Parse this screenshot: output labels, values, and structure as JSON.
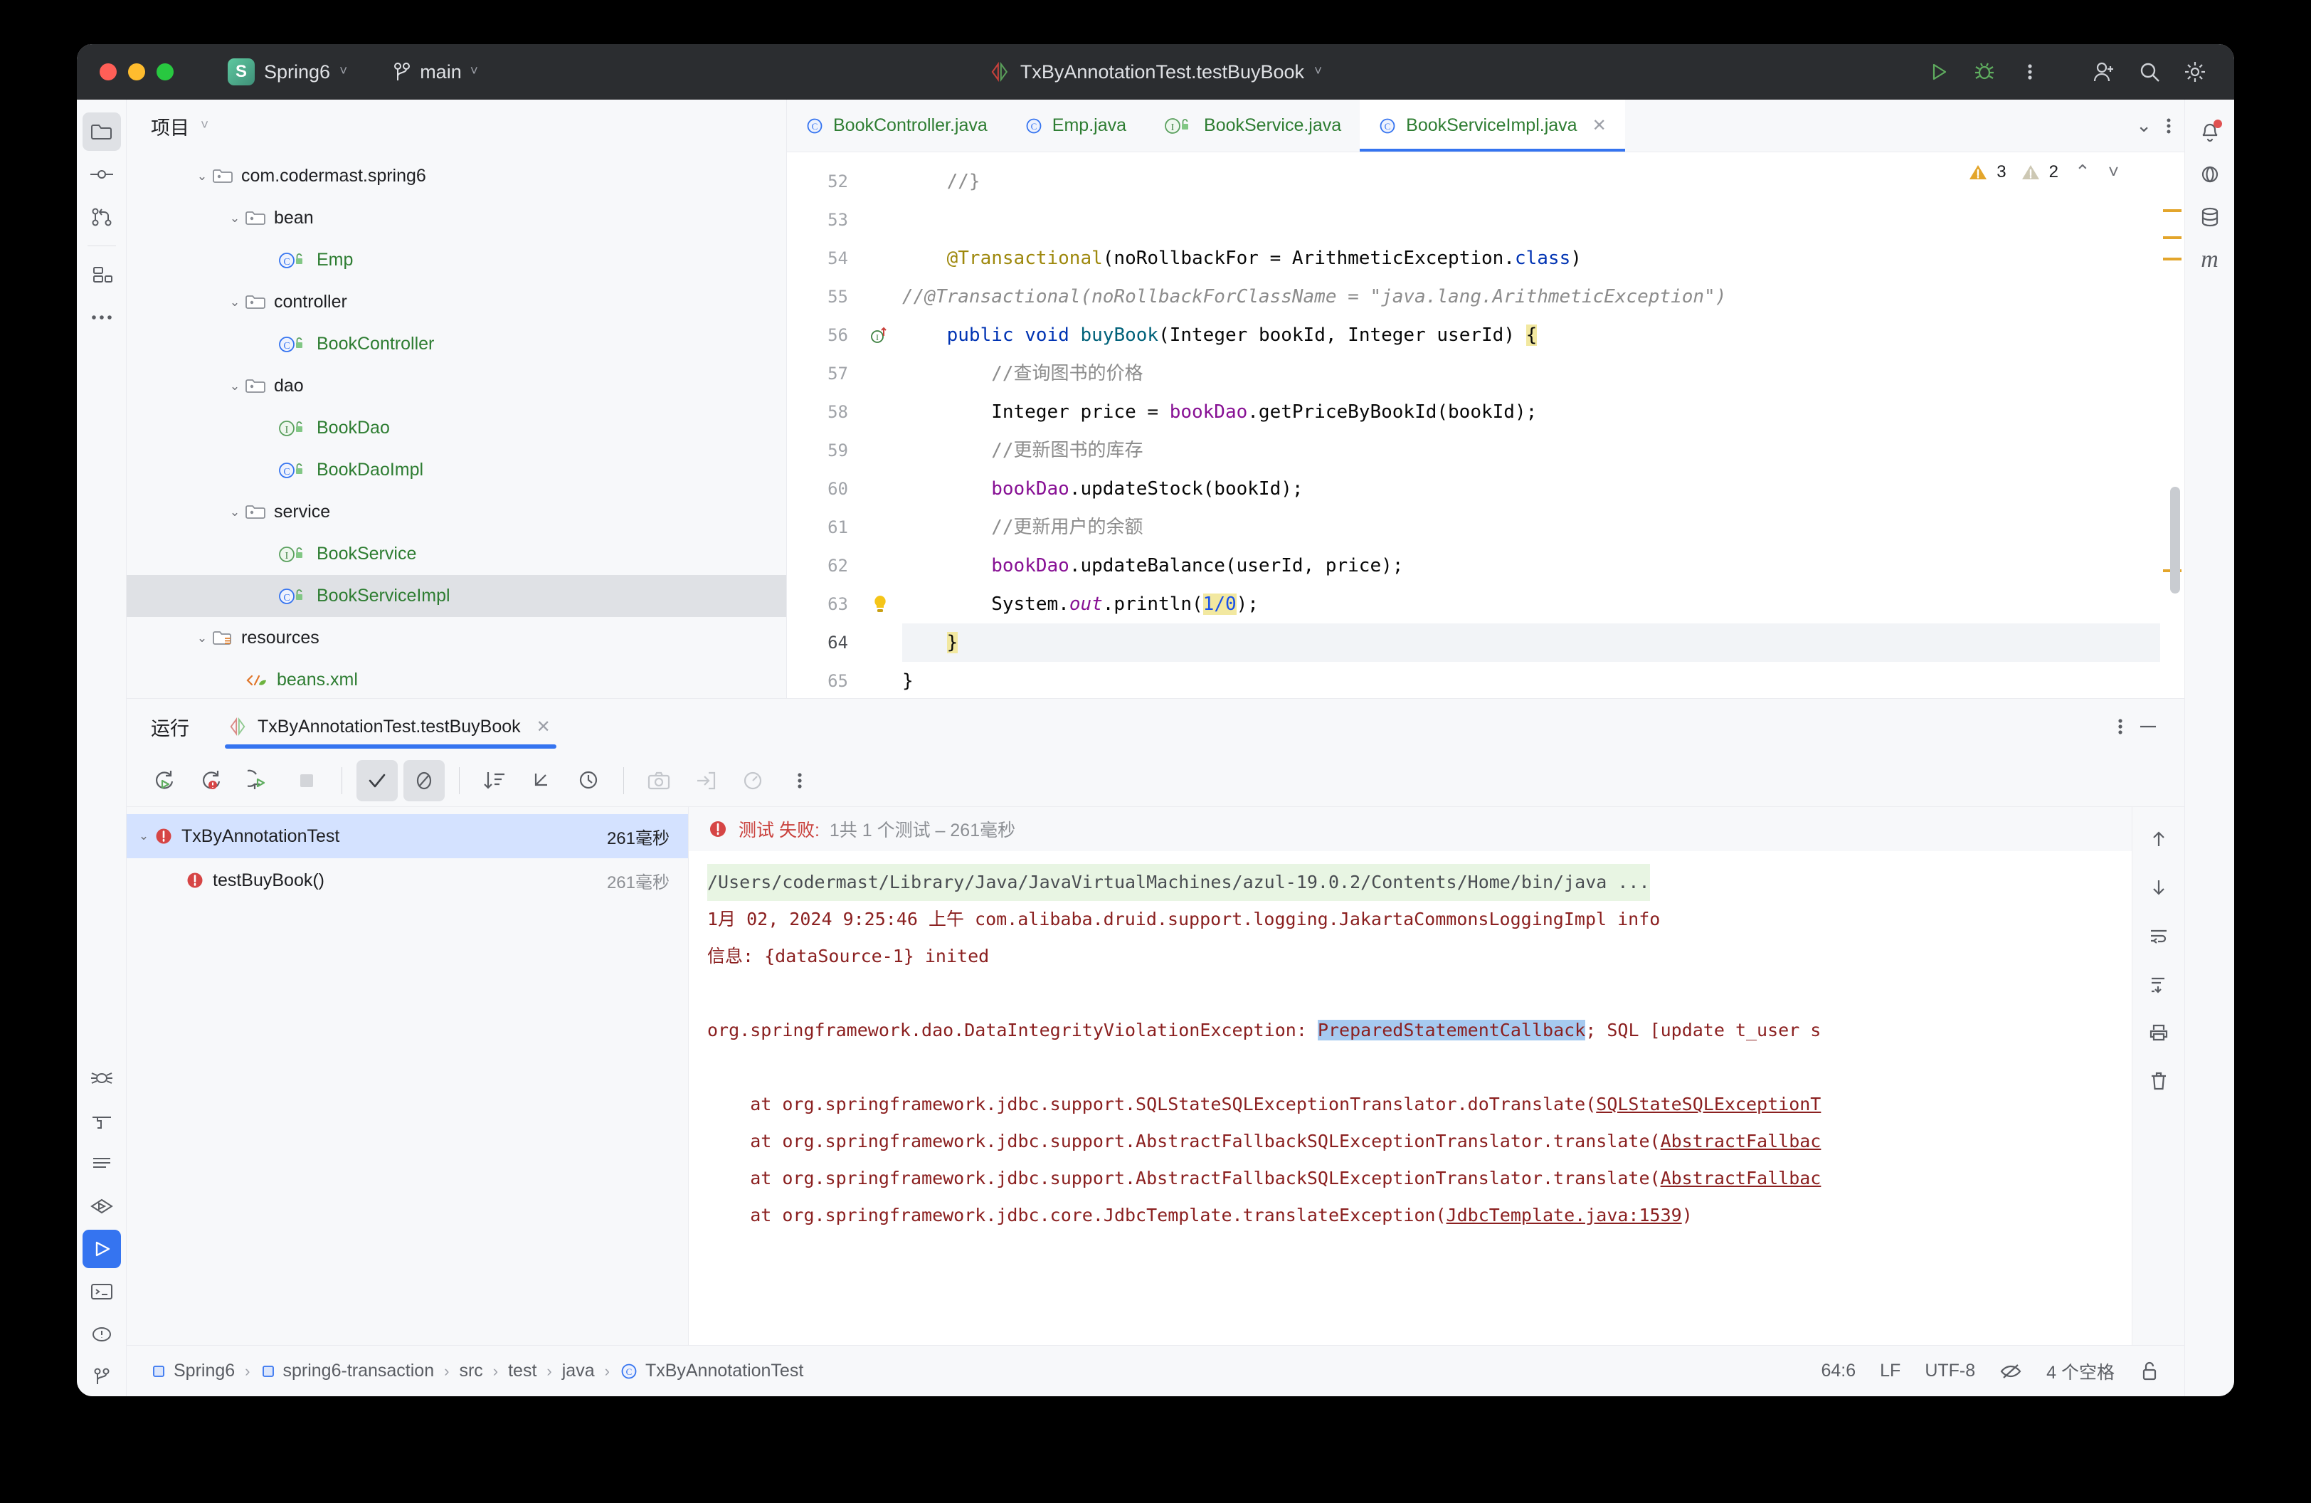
{
  "titlebar": {
    "project_name": "Spring6",
    "project_badge": "S",
    "branch": "main",
    "run_config": "TxByAnnotationTest.testBuyBook",
    "icons": {
      "run": "run-icon",
      "debug": "debug-icon",
      "more": "more-vertical-icon",
      "account": "account-icon",
      "search": "search-icon",
      "settings": "settings-icon"
    }
  },
  "rail": {
    "top": [
      {
        "name": "project-tool-window",
        "label": "Project",
        "selected": true
      },
      {
        "name": "commit-tool-window",
        "label": "Commit",
        "selected": false
      },
      {
        "name": "pull-requests-tool-window",
        "label": "Pull Requests",
        "selected": false
      },
      {
        "name": "structure-tool-window",
        "label": "Structure",
        "selected": false
      },
      {
        "name": "more-tool-windows",
        "label": "More",
        "selected": false
      }
    ],
    "bottom": [
      {
        "name": "debug-tool-window",
        "label": "Debug",
        "active": false
      },
      {
        "name": "build-tool-window",
        "label": "Build",
        "active": false
      },
      {
        "name": "notifications-tool-window",
        "label": "Notifications",
        "active": false
      },
      {
        "name": "services-tool-window",
        "label": "Services",
        "active": false
      },
      {
        "name": "run-tool-window",
        "label": "Run",
        "active": true
      },
      {
        "name": "terminal-tool-window",
        "label": "Terminal",
        "active": false
      },
      {
        "name": "problems-tool-window",
        "label": "Problems",
        "active": false
      },
      {
        "name": "git-tool-window",
        "label": "Git",
        "active": false
      }
    ]
  },
  "right_rail": [
    {
      "name": "notifications-icon",
      "label": "Notifications",
      "badge": true
    },
    {
      "name": "ai-assistant-icon",
      "label": "AI Assistant"
    },
    {
      "name": "database-icon",
      "label": "Database"
    },
    {
      "name": "maven-icon",
      "label": "Maven"
    }
  ],
  "project_panel": {
    "title": "项目",
    "tree": [
      {
        "depth": 2,
        "arrow": "down",
        "icon": "package-icon",
        "label": "com.codermast.spring6",
        "color": "black"
      },
      {
        "depth": 3,
        "arrow": "down",
        "icon": "package-icon",
        "label": "bean",
        "color": "black"
      },
      {
        "depth": 4,
        "arrow": "none",
        "icon": "class-icon",
        "label": "Emp",
        "color": "green"
      },
      {
        "depth": 3,
        "arrow": "down",
        "icon": "package-icon",
        "label": "controller",
        "color": "black"
      },
      {
        "depth": 4,
        "arrow": "none",
        "icon": "class-icon",
        "label": "BookController",
        "color": "green"
      },
      {
        "depth": 3,
        "arrow": "down",
        "icon": "package-icon",
        "label": "dao",
        "color": "black"
      },
      {
        "depth": 4,
        "arrow": "none",
        "icon": "interface-icon",
        "label": "BookDao",
        "color": "green"
      },
      {
        "depth": 4,
        "arrow": "none",
        "icon": "class-icon",
        "label": "BookDaoImpl",
        "color": "green"
      },
      {
        "depth": 3,
        "arrow": "down",
        "icon": "package-icon",
        "label": "service",
        "color": "black"
      },
      {
        "depth": 4,
        "arrow": "none",
        "icon": "interface-icon",
        "label": "BookService",
        "color": "green"
      },
      {
        "depth": 4,
        "arrow": "none",
        "icon": "class-icon",
        "label": "BookServiceImpl",
        "color": "green",
        "selected": true
      },
      {
        "depth": 2,
        "arrow": "down",
        "icon": "resources-folder-icon",
        "label": "resources",
        "color": "black"
      },
      {
        "depth": 3,
        "arrow": "none",
        "icon": "xml-spring-icon",
        "label": "beans.xml",
        "color": "green"
      }
    ]
  },
  "editor": {
    "tabs": [
      {
        "label": "BookController.java",
        "icon": "class-icon",
        "active": false
      },
      {
        "label": "Emp.java",
        "icon": "class-icon",
        "active": false
      },
      {
        "label": "BookService.java",
        "icon": "interface-icon",
        "active": false
      },
      {
        "label": "BookServiceImpl.java",
        "icon": "class-icon",
        "active": true
      }
    ],
    "inspection": {
      "warnings": "3",
      "weak_warnings": "2"
    },
    "first_line": 52,
    "current_line": 64,
    "lines": [
      {
        "n": 52,
        "gutter": "",
        "tokens": [
          {
            "t": "    //}",
            "c": "cmt"
          }
        ]
      },
      {
        "n": 53,
        "gutter": "",
        "tokens": [
          {
            "t": "",
            "c": ""
          }
        ]
      },
      {
        "n": 54,
        "gutter": "",
        "tokens": [
          {
            "t": "    ",
            "c": ""
          },
          {
            "t": "@Transactional",
            "c": "ann"
          },
          {
            "t": "(noRollbackFor = ArithmeticException.",
            "c": ""
          },
          {
            "t": "class",
            "c": "kw"
          },
          {
            "t": ")",
            "c": ""
          }
        ]
      },
      {
        "n": 55,
        "gutter": "",
        "tokens": [
          {
            "t": "//@Transactional(noRollbackForClassName = \"java.lang.ArithmeticException\")",
            "c": "cmt-i"
          }
        ]
      },
      {
        "n": 56,
        "gutter": "implemented-method-icon",
        "tokens": [
          {
            "t": "    ",
            "c": ""
          },
          {
            "t": "public",
            "c": "kw"
          },
          {
            "t": " ",
            "c": ""
          },
          {
            "t": "void",
            "c": "kw"
          },
          {
            "t": " ",
            "c": ""
          },
          {
            "t": "buyBook",
            "c": "mth"
          },
          {
            "t": "(Integer bookId, Integer userId) ",
            "c": ""
          },
          {
            "t": "{",
            "c": "caret-hl"
          }
        ]
      },
      {
        "n": 57,
        "gutter": "",
        "tokens": [
          {
            "t": "        //查询图书的价格",
            "c": "cmt"
          }
        ]
      },
      {
        "n": 58,
        "gutter": "",
        "tokens": [
          {
            "t": "        Integer price = ",
            "c": ""
          },
          {
            "t": "bookDao",
            "c": "fld"
          },
          {
            "t": ".getPriceByBookId(bookId);",
            "c": ""
          }
        ]
      },
      {
        "n": 59,
        "gutter": "",
        "tokens": [
          {
            "t": "        //更新图书的库存",
            "c": "cmt"
          }
        ]
      },
      {
        "n": 60,
        "gutter": "",
        "tokens": [
          {
            "t": "        ",
            "c": ""
          },
          {
            "t": "bookDao",
            "c": "fld"
          },
          {
            "t": ".updateStock(bookId);",
            "c": ""
          }
        ]
      },
      {
        "n": 61,
        "gutter": "",
        "tokens": [
          {
            "t": "        //更新用户的余额",
            "c": "cmt"
          }
        ]
      },
      {
        "n": 62,
        "gutter": "",
        "tokens": [
          {
            "t": "        ",
            "c": ""
          },
          {
            "t": "bookDao",
            "c": "fld"
          },
          {
            "t": ".updateBalance(userId, price);",
            "c": ""
          }
        ]
      },
      {
        "n": 63,
        "gutter": "intention-bulb-icon",
        "tokens": [
          {
            "t": "        System.",
            "c": ""
          },
          {
            "t": "out",
            "c": "stat"
          },
          {
            "t": ".println(",
            "c": ""
          },
          {
            "t": "1/0",
            "c": "num"
          },
          {
            "t": ");",
            "c": ""
          }
        ]
      },
      {
        "n": 64,
        "gutter": "",
        "tokens": [
          {
            "t": "    ",
            "c": ""
          },
          {
            "t": "}",
            "c": "caret-hl"
          }
        ]
      },
      {
        "n": 65,
        "gutter": "",
        "tokens": [
          {
            "t": "}",
            "c": ""
          }
        ]
      }
    ]
  },
  "run_panel": {
    "title": "运行",
    "tab_label": "TxByAnnotationTest.testBuyBook",
    "toolbar": [
      {
        "name": "rerun-button",
        "label": "Rerun",
        "state": "normal"
      },
      {
        "name": "rerun-failed-tests-button",
        "label": "Rerun Failed Tests",
        "state": "normal"
      },
      {
        "name": "rerun-with-debug-button",
        "label": "Debug",
        "state": "normal"
      },
      {
        "name": "stop-button",
        "label": "Stop",
        "state": "disabled"
      },
      {
        "name": "show-passed-toggle",
        "label": "Show Passed",
        "state": "on"
      },
      {
        "name": "show-ignored-toggle",
        "label": "Show Ignored",
        "state": "on"
      },
      {
        "name": "sort-by-duration-button",
        "label": "Sort by Duration",
        "state": "normal"
      },
      {
        "name": "expand-collapse-button",
        "label": "Expand/Collapse",
        "state": "normal"
      },
      {
        "name": "test-history-button",
        "label": "Test History",
        "state": "normal"
      },
      {
        "name": "screenshot-button",
        "label": "Screenshot",
        "state": "disabled"
      },
      {
        "name": "export-button",
        "label": "Export",
        "state": "disabled"
      },
      {
        "name": "profiler-button",
        "label": "Profiler",
        "state": "disabled"
      },
      {
        "name": "more-options-button",
        "label": "More",
        "state": "normal"
      }
    ],
    "tests": [
      {
        "label": "TxByAnnotationTest",
        "duration": "261毫秒",
        "status": "failed",
        "expandable": true,
        "selected": true,
        "indent": 0
      },
      {
        "label": "testBuyBook()",
        "duration": "261毫秒",
        "status": "failed",
        "expandable": false,
        "selected": false,
        "indent": 1
      }
    ],
    "failure_header": {
      "red": "测试 失败:",
      "gray": "1共 1 个测试 – 261毫秒"
    },
    "console": [
      {
        "type": "cmd",
        "text": "/Users/codermast/Library/Java/JavaVirtualMachines/azul-19.0.2/Contents/Home/bin/java ..."
      },
      {
        "type": "err",
        "text": "1月 02, 2024 9:25:46 上午 com.alibaba.druid.support.logging.JakartaCommonsLoggingImpl info"
      },
      {
        "type": "err",
        "text": "信息: {dataSource-1} inited"
      },
      {
        "type": "blank",
        "text": ""
      },
      {
        "type": "err-sel",
        "pre": "org.springframework.dao.DataIntegrityViolationException: ",
        "sel": "PreparedStatementCallback",
        "post": "; SQL [update t_user s"
      },
      {
        "type": "blank",
        "text": ""
      },
      {
        "type": "err-link",
        "pre": "    at org.springframework.jdbc.support.SQLStateSQLExceptionTranslator.doTranslate(",
        "link": "SQLStateSQLExceptionT"
      },
      {
        "type": "err-link",
        "pre": "    at org.springframework.jdbc.support.AbstractFallbackSQLExceptionTranslator.translate(",
        "link": "AbstractFallbac"
      },
      {
        "type": "err-link",
        "pre": "    at org.springframework.jdbc.support.AbstractFallbackSQLExceptionTranslator.translate(",
        "link": "AbstractFallbac"
      },
      {
        "type": "err-link",
        "pre": "    at org.springframework.jdbc.core.JdbcTemplate.translateException(",
        "link": "JdbcTemplate.java:1539",
        "post": ")"
      }
    ],
    "console_rail": [
      {
        "name": "scroll-up-icon",
        "label": "Up"
      },
      {
        "name": "scroll-down-icon",
        "label": "Down"
      },
      {
        "name": "soft-wrap-icon",
        "label": "Soft Wrap"
      },
      {
        "name": "scroll-to-end-icon",
        "label": "Scroll to End"
      },
      {
        "name": "print-icon",
        "label": "Print"
      },
      {
        "name": "clear-all-icon",
        "label": "Clear All"
      }
    ]
  },
  "status_bar": {
    "breadcrumbs": [
      {
        "label": "Spring6",
        "icon": "module-icon"
      },
      {
        "label": "spring6-transaction",
        "icon": "module-icon"
      },
      {
        "label": "src",
        "icon": "none"
      },
      {
        "label": "test",
        "icon": "none"
      },
      {
        "label": "java",
        "icon": "none"
      },
      {
        "label": "TxByAnnotationTest",
        "icon": "class-icon"
      }
    ],
    "caret_position": "64:6",
    "line_separator": "LF",
    "encoding": "UTF-8",
    "indent": "4 个空格",
    "icons": [
      {
        "name": "reader-mode-icon",
        "label": "Reader Mode"
      },
      {
        "name": "lock-icon",
        "label": "Read-only toggle"
      }
    ]
  },
  "colors": {
    "accent": "#3574f0",
    "titlebar_bg": "#2b2d30",
    "panel_bg": "#f7f8fa",
    "editor_bg": "#ffffff",
    "selection": "#d4e2ff",
    "error_red": "#c9413c",
    "console_err": "#8b2020",
    "green_text": "#2e7d32"
  }
}
